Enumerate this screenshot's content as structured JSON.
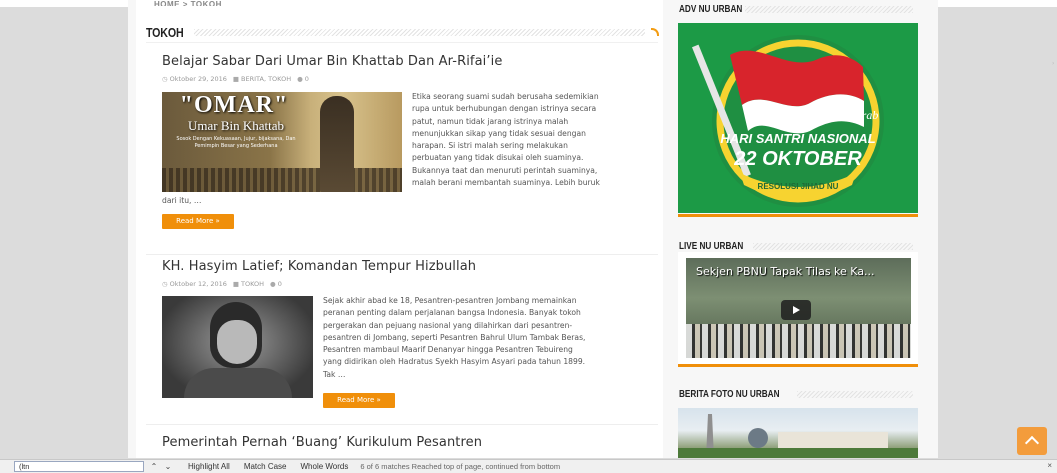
{
  "main": {
    "top_crumb": "HOME > TOKOH",
    "section_title": "TOKOH",
    "posts": [
      {
        "title": "Belajar Sabar Dari Umar Bin Khattab Dan Ar-Rifai’ie",
        "date": "Oktober 29, 2016",
        "categories": "BERITA, TOKOH",
        "comments": "0",
        "excerpt_lines": [
          "Etika seorang suami sudah berusaha sedemikian",
          "rupa untuk berhubungan dengan istrinya secara",
          "patut, namun tidak jarang istrinya malah",
          "menunjukkan sikap yang tidak sesuai dengan",
          "harapan. Si istri malah sering melakukan",
          "perbuatan yang tidak disukai oleh suaminya.",
          "Bukannya taat dan menuruti perintah suaminya,",
          "malah berani membantah suaminya. Lebih buruk"
        ],
        "excerpt_tail": "dari itu, …",
        "thumb_title": "\"OMAR\"",
        "thumb_subtitle": "Umar Bin Khattab",
        "thumb_tagline": "Sosok Dengan Kekuasaan, Jujur, bijaksana, Dan Pemimpin Besar yang Sederhana",
        "read_more": "Read More »"
      },
      {
        "title": "KH. Hasyim Latief; Komandan Tempur Hizbullah",
        "date": "Oktober 12, 2016",
        "categories": "TOKOH",
        "comments": "0",
        "excerpt_lines": [
          "Sejak akhir abad ke 18, Pesantren-pesantren Jombang memainkan",
          "peranan penting dalam perjalanan bangsa Indonesia. Banyak tokoh",
          "pergerakan dan pejuang nasional yang dilahirkan dari pesantren-",
          "pesantren di Jombang, seperti Pesantren Bahrul Ulum Tambak Beras,",
          "Pesantren mambaul Maarif Denanyar hingga Pesantren Tebuireng",
          "yang didirikan oleh Hadratus Syekh Hasyim Asyari pada tahun 1899.",
          "Tak …"
        ],
        "read_more": "Read More »"
      },
      {
        "title": "Pemerintah Pernah ‘Buang’ Kurikulum Pesantren"
      }
    ]
  },
  "sidebar": {
    "adv_title": "ADV NU URBAN",
    "adv": {
      "kirab": "kirab",
      "line1": "HARI SANTRI NASIONAL",
      "line2": "22 OKTOBER",
      "ribbon": "RESOLUSI JIHAD NU"
    },
    "live_title": "LIVE NU URBAN",
    "video_title": "Sekjen PBNU Tapak Tilas ke Ka...",
    "foto_title": "BERITA FOTO NU URBAN"
  },
  "findbar": {
    "query": "(ltn",
    "highlight_all": "Highlight All",
    "match_case": "Match Case",
    "whole_words": "Whole Words",
    "status": "6 of 6 matches    Reached top of page, continued from bottom",
    "close": "×"
  },
  "colors": {
    "accent": "#f08f0a",
    "adv_green": "#1c9a46",
    "flag_red": "#d8242c"
  }
}
